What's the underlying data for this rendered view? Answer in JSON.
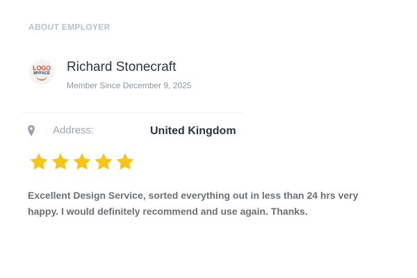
{
  "section": {
    "title": "ABOUT EMPLOYER"
  },
  "employer": {
    "logo_text_top": "LOGO",
    "logo_text_bottom": "MYFACE",
    "name": "Richard Stonecraft",
    "member_since": "Member Since December 9, 2025"
  },
  "address": {
    "label": "Address:",
    "value": "United Kingdom",
    "icon": "map-pin-icon"
  },
  "rating": {
    "stars": 5,
    "max_stars": 5,
    "star_color": "#f5c518"
  },
  "review": {
    "text": "Excellent Design Service, sorted everything out in less than 24 hrs very happy. I would definitely recommend and use again. Thanks."
  },
  "colors": {
    "section_title": "#b9c0c9",
    "name": "#2a3443",
    "muted": "#8b95a2",
    "address_value": "#2b3342",
    "review_text": "#6c6f73",
    "logo_red": "#d84a2b",
    "logo_orange": "#e07a2e"
  }
}
